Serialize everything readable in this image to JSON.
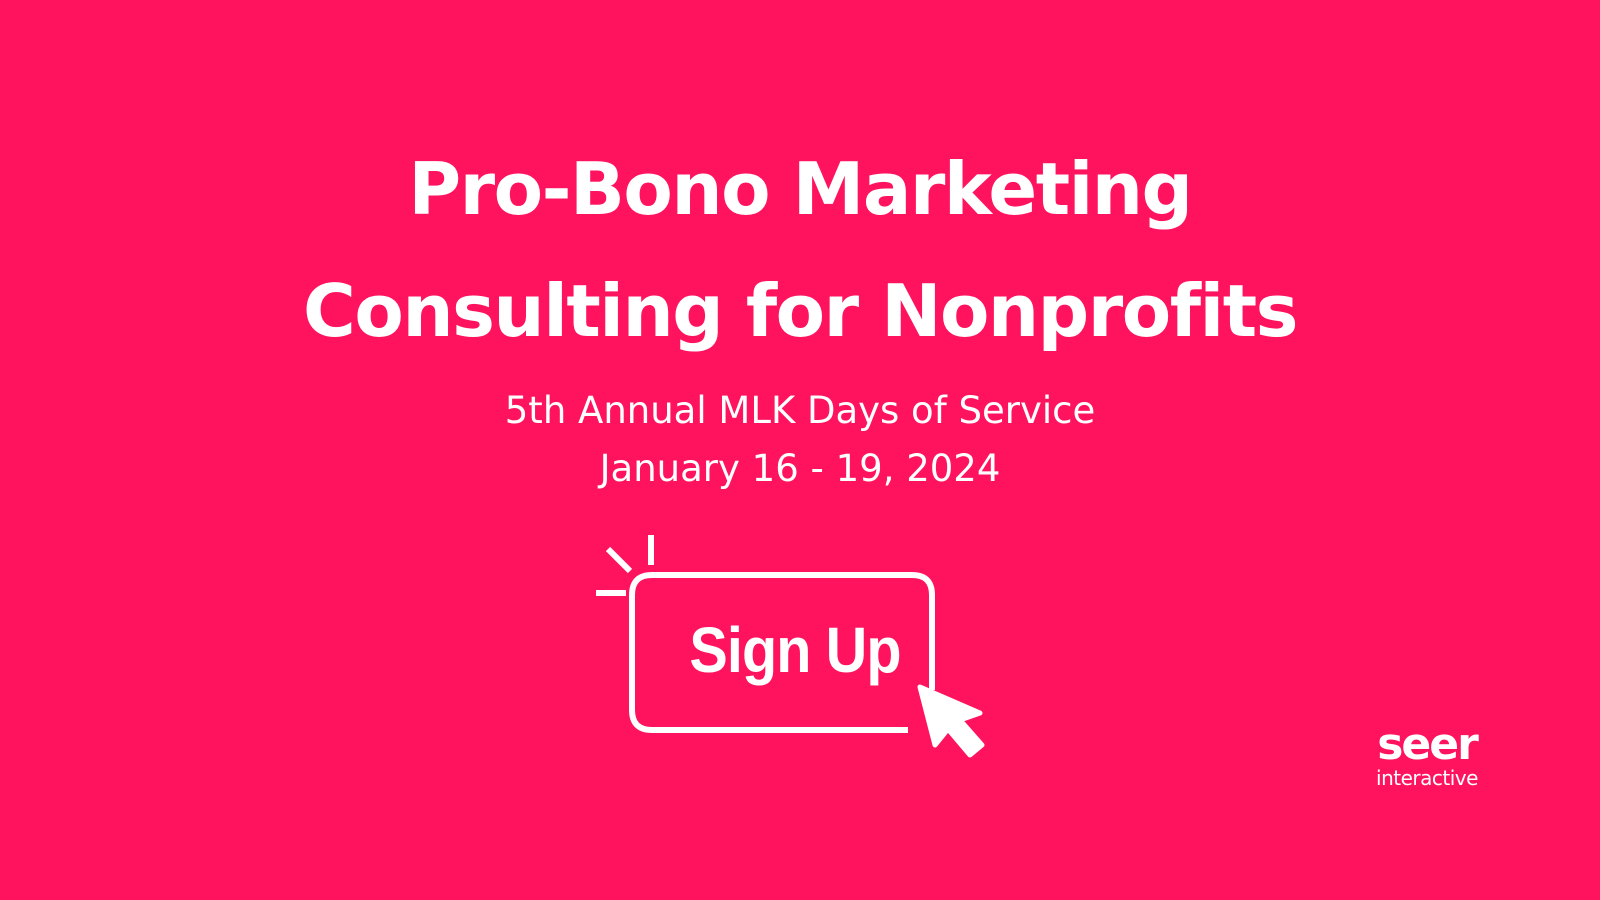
{
  "headline": {
    "line1": "Pro-Bono Marketing",
    "line2": "Consulting for Nonprofits"
  },
  "event": {
    "name": "5th Annual MLK Days of Service",
    "dates": "January 16 - 19, 2024"
  },
  "cta": {
    "label": "Sign Up"
  },
  "logo": {
    "brand": "seer",
    "tagline": "interactive"
  },
  "colors": {
    "background": "#ff135e",
    "foreground": "#ffffff"
  },
  "icons": {
    "cursor": "cursor-arrow-icon",
    "click_burst": "click-burst-icon"
  }
}
